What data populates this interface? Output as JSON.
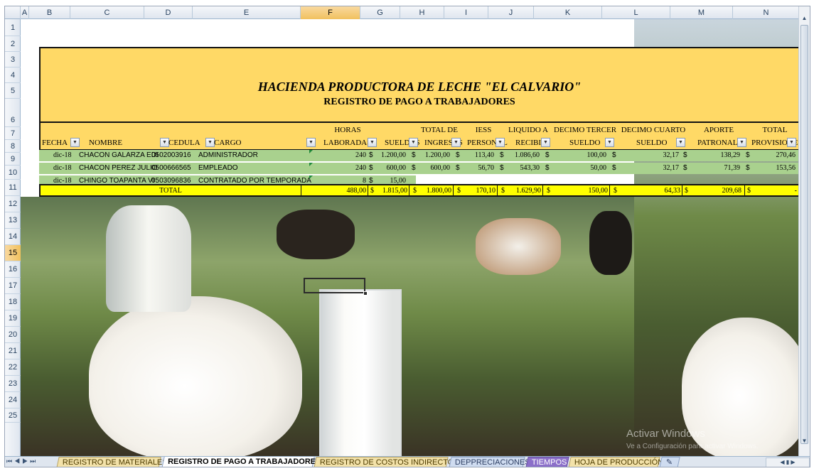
{
  "columns": [
    "A",
    "B",
    "C",
    "D",
    "E",
    "F",
    "G",
    "H",
    "I",
    "J",
    "K",
    "L",
    "M",
    "N"
  ],
  "selected_column": "F",
  "rows": [
    "1",
    "2",
    "3",
    "4",
    "5",
    "6",
    "7",
    "8",
    "9",
    "10",
    "11",
    "12",
    "13",
    "14",
    "15",
    "16",
    "17",
    "18",
    "19",
    "20",
    "21",
    "22",
    "23",
    "24",
    "25"
  ],
  "selected_row": "15",
  "title": {
    "line1": "HACIENDA PRODUCTORA DE LECHE \"EL CALVARIO\"",
    "line2": "REGISTRO DE PAGO A TRABAJADORES"
  },
  "headers": {
    "fecha": "FECHA",
    "nombre": "NOMBRE",
    "cedula": "CEDULA",
    "cargo": "CARGO",
    "horas_1": "HORAS",
    "horas_2": "LABORADAS",
    "sueldos": "SUELDOS",
    "total_1": "TOTAL DE",
    "total_2": "INGRESOS",
    "iess_1": "IESS",
    "iess_2": "PERSONAL",
    "liquido_1": "LIQUIDO A",
    "liquido_2": "RECIBIR",
    "decimo3_1": "DECIMO TERCER",
    "decimo3_2": "SUELDO",
    "decimo4_1": "DECIMO CUARTO",
    "decimo4_2": "SUELDO",
    "aporte_1": "APORTE",
    "aporte_2": "PATRONAL",
    "provisiones_1": "TOTAL",
    "provisiones_2": "PROVISIONES"
  },
  "data_rows": [
    {
      "fecha": "dic-18",
      "nombre": "CHACON GALARZA EDI",
      "cedula": "0502003916",
      "cargo": "ADMINISTRADOR",
      "horas": "240",
      "sueldo": "1.200,00",
      "ingresos": "1.200,00",
      "iess": "113,40",
      "liquido": "1.086,60",
      "decimo3": "100,00",
      "decimo4": "32,17",
      "aporte": "138,29",
      "provisiones": "270,46"
    },
    {
      "fecha": "dic-18",
      "nombre": "CHACON PEREZ JULIO",
      "cedula": "0500666565",
      "cargo": "EMPLEADO",
      "horas": "240",
      "sueldo": "600,00",
      "ingresos": "600,00",
      "iess": "56,70",
      "liquido": "543,30",
      "decimo3": "50,00",
      "decimo4": "32,17",
      "aporte": "71,39",
      "provisiones": "153,56"
    },
    {
      "fecha": "dic-18",
      "nombre": "CHINGO TOAPANTA VI",
      "cedula": "0503096836",
      "cargo": "CONTRATADO POR TEMPORADA",
      "horas": "8",
      "sueldo": "15,00",
      "ingresos": "",
      "iess": "",
      "liquido": "",
      "decimo3": "",
      "decimo4": "",
      "aporte": "",
      "provisiones": ""
    }
  ],
  "currency_symbol": "$",
  "totals": {
    "label": "TOTAL",
    "horas": "488,00",
    "sueldo": "1.815,00",
    "ingresos": "1.800,00",
    "iess": "170,10",
    "liquido": "1.629,90",
    "decimo3": "150,00",
    "decimo4": "64,33",
    "aporte": "209,68",
    "provisiones": "-"
  },
  "watermark": {
    "line1": "Activar Windows",
    "line2": "Ve a Configuración para activar Windows."
  },
  "sheet_tabs": [
    "REGISTRO DE MATERIALES",
    "REGISTRO DE PAGO A TRABAJADORES",
    "REGISTRO DE COSTOS INDIRECTOS",
    "DEPPRECIACIONES",
    "TIEMPOS",
    "HOJA DE PRODUCCIÓN"
  ],
  "active_tab": "REGISTRO DE PAGO A TRABAJADORES"
}
